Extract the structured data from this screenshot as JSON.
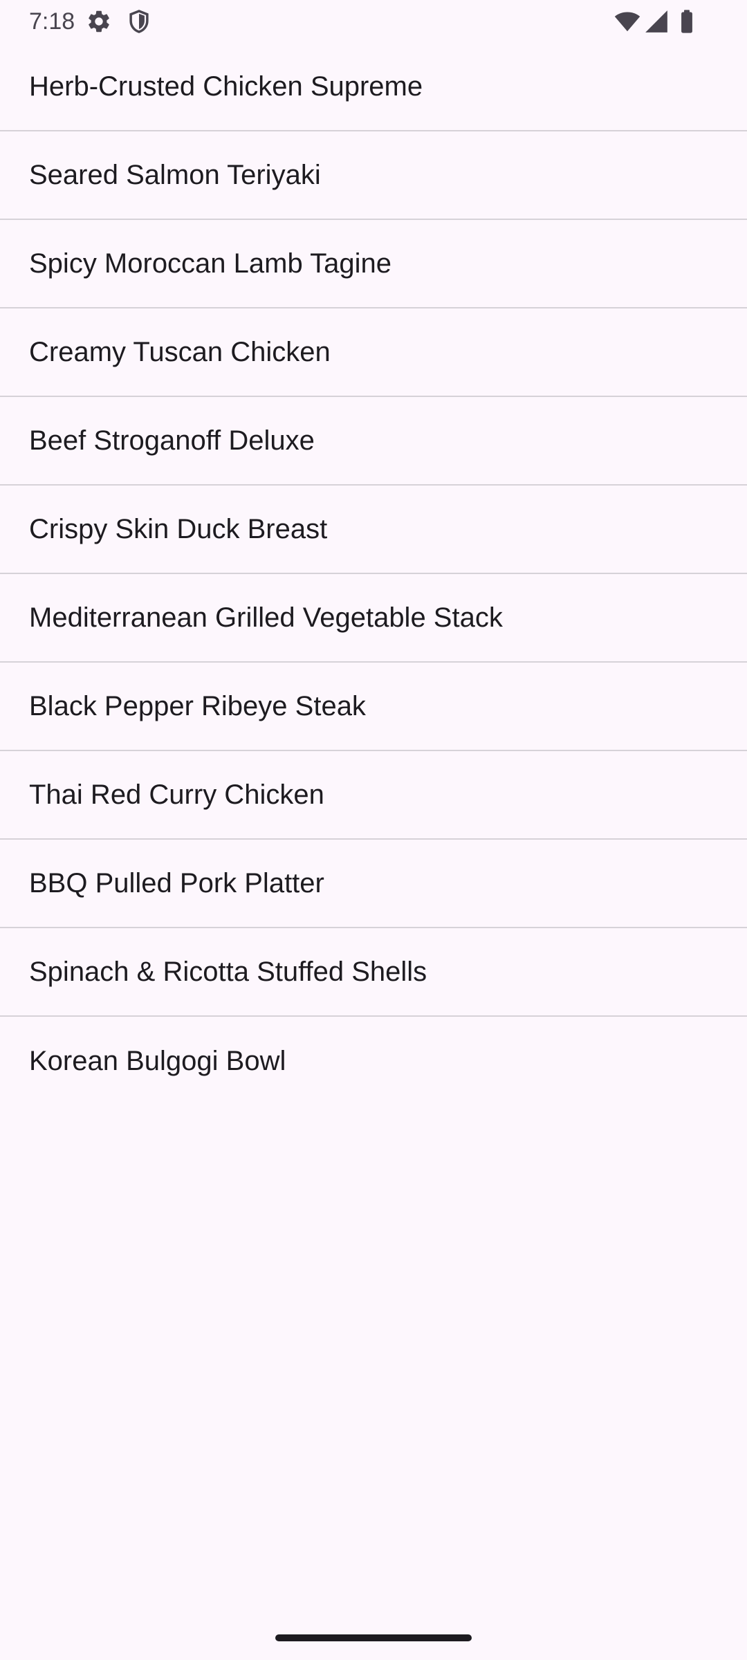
{
  "status_bar": {
    "time": "7:18",
    "icons": [
      "settings-gear-icon",
      "shield-icon",
      "wifi-icon",
      "cellular-signal-icon",
      "battery-icon"
    ]
  },
  "colors": {
    "background": "#fdf7fd",
    "text": "#1d1b20",
    "divider": "#d6d2d8",
    "status_icon": "#49454f"
  },
  "menu": {
    "items": [
      {
        "label": "Herb-Crusted Chicken Supreme"
      },
      {
        "label": "Seared Salmon Teriyaki"
      },
      {
        "label": "Spicy Moroccan Lamb Tagine"
      },
      {
        "label": "Creamy Tuscan Chicken"
      },
      {
        "label": "Beef Stroganoff Deluxe"
      },
      {
        "label": "Crispy Skin Duck Breast"
      },
      {
        "label": "Mediterranean Grilled Vegetable Stack"
      },
      {
        "label": "Black Pepper Ribeye Steak"
      },
      {
        "label": "Thai Red Curry Chicken"
      },
      {
        "label": "BBQ Pulled Pork Platter"
      },
      {
        "label": "Spinach & Ricotta Stuffed Shells"
      },
      {
        "label": "Korean Bulgogi Bowl"
      }
    ]
  }
}
